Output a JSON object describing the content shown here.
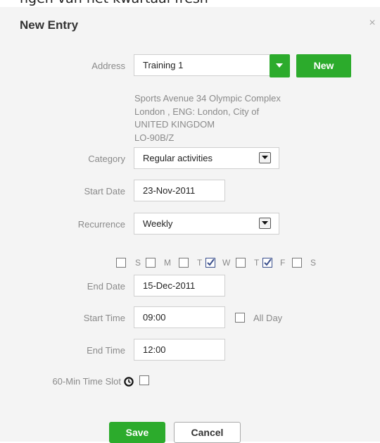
{
  "background_text": "ngen van het kwartaal fresh",
  "dialog": {
    "title": "New Entry",
    "close_symbol": "×",
    "address": {
      "label": "Address",
      "value": "Training 1",
      "new_button": "New",
      "details": [
        "Sports Avenue 34 Olympic Complex",
        "London , ENG: London, City of",
        "UNITED KINGDOM",
        "LO-90B/Z"
      ]
    },
    "category": {
      "label": "Category",
      "value": "Regular activities"
    },
    "start_date": {
      "label": "Start Date",
      "value": "23-Nov-2011"
    },
    "recurrence": {
      "label": "Recurrence",
      "value": "Weekly"
    },
    "days": [
      {
        "letter": "S",
        "checked": false
      },
      {
        "letter": "M",
        "checked": false
      },
      {
        "letter": "T",
        "checked": false
      },
      {
        "letter": "W",
        "checked": true
      },
      {
        "letter": "T",
        "checked": false
      },
      {
        "letter": "F",
        "checked": true
      },
      {
        "letter": "S",
        "checked": false
      }
    ],
    "end_date": {
      "label": "End Date",
      "value": "15-Dec-2011"
    },
    "start_time": {
      "label": "Start Time",
      "value": "09:00",
      "all_day_label": "All Day"
    },
    "end_time": {
      "label": "End Time",
      "value": "12:00"
    },
    "time_slot": {
      "label": "60-Min Time Slot",
      "icon": "clock-icon"
    },
    "buttons": {
      "save": "Save",
      "cancel": "Cancel"
    }
  },
  "colors": {
    "accent_green": "#2cab2c",
    "panel_bg": "#f4f4f4",
    "label_gray": "#8a8a8a"
  }
}
